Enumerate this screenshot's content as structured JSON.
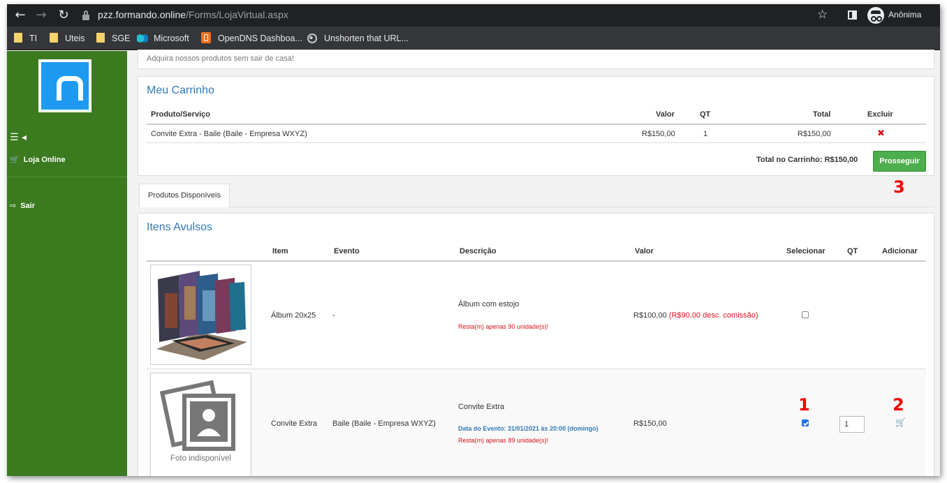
{
  "browser": {
    "url_host": "pzz.formando.online",
    "url_path": "/Forms/LojaVirtual.aspx",
    "profile_label": "Anônima",
    "bookmarks": [
      "TI",
      "Uteis",
      "SGE",
      "Microsoft",
      "OpenDNS Dashboa...",
      "Unshorten that URL..."
    ]
  },
  "sidebar": {
    "items": [
      {
        "label": "Loja Online"
      },
      {
        "label": "Sair"
      }
    ]
  },
  "header": {
    "tagline": "Adquira nossos produtos sem sair de casa!"
  },
  "cart": {
    "title": "Meu Carrinho",
    "columns": [
      "Produto/Serviço",
      "Valor",
      "QT",
      "Total",
      "Excluir"
    ],
    "rows": [
      {
        "product": "Convite Extra - Baile (Baile - Empresa WXYZ)",
        "value": "R$150,00",
        "qty": "1",
        "total": "R$150,00"
      }
    ],
    "total_label": "Total no Carrinho: R$150,00",
    "proceed_label": "Prosseguir"
  },
  "tabs": [
    {
      "label": "Produtos Disponíveis"
    }
  ],
  "items": {
    "title": "Itens Avulsos",
    "columns": [
      "Item",
      "Evento",
      "Descrição",
      "Valor",
      "Selecionar",
      "QT",
      "Adicionar"
    ],
    "rows": [
      {
        "item": "Álbum 20x25",
        "event": "-",
        "description": "Álbum com estojo",
        "event_date": "",
        "remaining": "Resta(m) apenas 90 unidade(s)!",
        "value": "R$100,00",
        "discount": "(R$90,00 desc. comissão)",
        "selected": false
      },
      {
        "item": "Convite Extra",
        "event": "Baile (Baile - Empresa WXYZ)",
        "description": "Convite Extra",
        "event_date": "Data do Evento: 31/01/2021 às 20:00 (domingo)",
        "remaining": "Resta(m) apenas 89 unidade(s)!",
        "value": "R$150,00",
        "discount": "",
        "selected": true,
        "qty": "1",
        "photo_caption": "Foto indisponível"
      }
    ]
  },
  "annotations": [
    "1",
    "2",
    "3"
  ],
  "colors": {
    "sidebar_green": "#3b7a1f",
    "accent_blue": "#337ab7",
    "button_green": "#4cae4c",
    "alert_red": "#d9121d",
    "annotation_red": "#e00000"
  }
}
